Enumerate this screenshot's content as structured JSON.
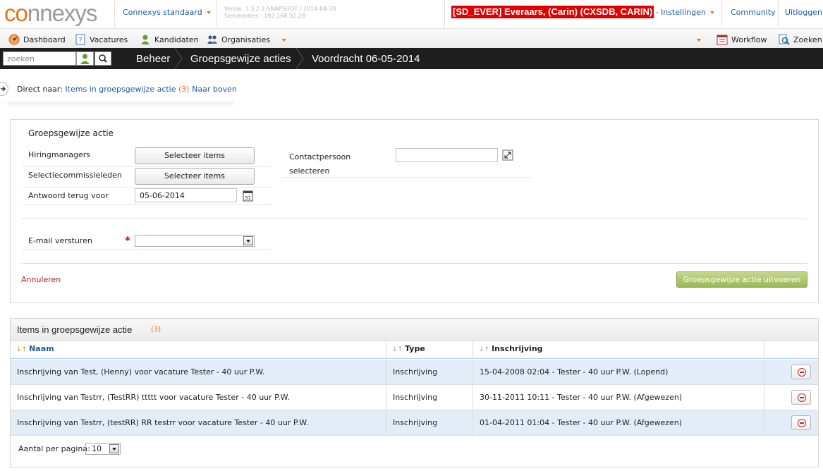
{
  "header": {
    "logo_part1": "co",
    "logo_part2": "nnexys",
    "environment": "Connexys standaard",
    "version_line1": "Versie: 3.3.2.1-SNAPSHOT / 2014-04-30",
    "version_line2": "Serveradres : 192.168.32.28",
    "user": "[SD_EVER] Everaars, (Carin) (CXSDB, CARIN)",
    "settings": "Instellingen",
    "community": "Community",
    "logout": "Uitloggen"
  },
  "nav": {
    "dashboard": "Dashboard",
    "vacatures": "Vacatures",
    "kandidaten": "Kandidaten",
    "organisaties": "Organisaties",
    "workflow": "Workflow",
    "zoeken": "Zoeken"
  },
  "breadcrumb": {
    "search_placeholder": "zoeken",
    "items": [
      "Beheer",
      "Groepsgewijze acties",
      "Voordracht 06-05-2014"
    ]
  },
  "direct": {
    "label": "Direct naar:",
    "items_link": "Items in groepsgewijze actie",
    "items_count": "(3)",
    "top_link": "Naar boven"
  },
  "form": {
    "title": "Groepsgewijze actie",
    "hiring_label": "Hiringmanagers",
    "hiring_button": "Selecteer items",
    "committee_label": "Selectiecommissieleden",
    "committee_button": "Selecteer items",
    "answer_label": "Antwoord terug voor",
    "answer_value": "05-06-2014",
    "contact_label_line1": "Contactpersoon",
    "contact_label_line2": "selecteren",
    "contact_value": "",
    "email_label": "E-mail versturen",
    "email_required": "*",
    "email_value": "",
    "cancel": "Annuleren",
    "execute": "Groepsgewijze actie uitvoeren"
  },
  "items": {
    "title": "Items in groepsgewijze actie",
    "count": "(3)",
    "columns": [
      "Naam",
      "Type",
      "Inschrijving"
    ],
    "sort_arrows": [
      "↓↑",
      "↓↑",
      "↓↑"
    ],
    "rows": [
      {
        "naam": "Inschrijving van Test, (Henny) voor vacature Tester - 40 uur P.W.",
        "type": "Inschrijving",
        "inschrijving": "15-04-2008 02:04 - Tester - 40 uur P.W. (Lopend)"
      },
      {
        "naam": "Inschrijving van Testrr, (TestRR) ttttt voor vacature Tester - 40 uur P.W.",
        "type": "Inschrijving",
        "inschrijving": "30-11-2011 10:11 - Tester - 40 uur P.W. (Afgewezen)"
      },
      {
        "naam": "Inschrijving van Testrr, (testRR) RR testrr voor vacature Tester - 40 uur P.W.",
        "type": "Inschrijving",
        "inschrijving": "01-04-2011 01:04 - Tester - 40 uur P.W. (Afgewezen)"
      }
    ],
    "per_page_label": "Aantal per pagina:",
    "per_page_value": "10"
  },
  "colors": {
    "brand_orange": "#e8731a",
    "link_blue": "#1b5aa6",
    "crumb_bg": "#1e1e1e",
    "user_badge": "#e00000",
    "execute_green": "#9cb854",
    "row_alt": "#e3edf8"
  },
  "icons": {
    "dashboard": "speedometer-icon",
    "vacatures": "document-question-icon",
    "kandidaten": "person-icon",
    "organisaties": "group-icon",
    "workflow": "calendar-list-icon",
    "zoeken": "search-document-icon",
    "remove": "remove-circle-icon",
    "calendar": "calendar-icon",
    "popup": "expand-icon"
  }
}
